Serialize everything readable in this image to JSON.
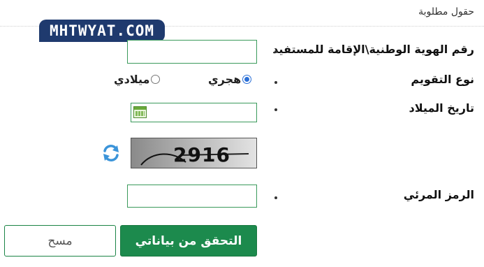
{
  "header": {
    "required_fields_label": "حقول مطلوبة"
  },
  "watermark": {
    "text": "MHTWYAT.COM"
  },
  "form": {
    "id_label": "رقم الهوية الوطنية\\الإقامة للمستفيد",
    "id_value": "",
    "calendar_type_label": "نوع التقويم",
    "calendar_options": [
      {
        "label": "هجري",
        "checked": true
      },
      {
        "label": "ميلادي",
        "checked": false
      }
    ],
    "birth_date_label": "تاريخ الميلاد",
    "birth_date_value": "",
    "captcha_text": "2916",
    "captcha_label": "الرمز المرئي",
    "captcha_value": ""
  },
  "buttons": {
    "clear_label": "مسح",
    "verify_label": "التحقق من بياناتي"
  },
  "colors": {
    "accent": "#1c8a4d",
    "field_border": "#3a9a5b",
    "radio_checked": "#2a6fd6",
    "refresh_icon": "#3b94d9",
    "watermark_bg": "#1f3a6e"
  }
}
